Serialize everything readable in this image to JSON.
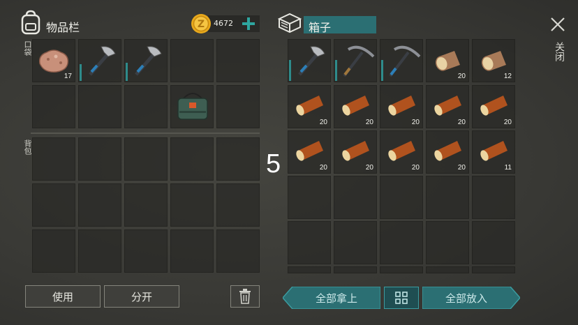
{
  "inventory": {
    "title": "物品栏",
    "coins": "4672",
    "pocket_label": "口袋",
    "backpack_label": "背包",
    "pocket_slots": [
      {
        "item": "stone",
        "count": "17"
      },
      {
        "item": "hatchet",
        "count": ""
      },
      {
        "item": "hatchet",
        "count": ""
      },
      {
        "item": "",
        "count": ""
      },
      {
        "item": "",
        "count": ""
      },
      {
        "item": "",
        "count": ""
      },
      {
        "item": "",
        "count": ""
      },
      {
        "item": "",
        "count": ""
      },
      {
        "item": "bag",
        "count": ""
      },
      {
        "item": "",
        "count": ""
      }
    ],
    "use_button": "使用",
    "split_button": "分开"
  },
  "box": {
    "title": "箱子",
    "close_label": "关闭",
    "slots": [
      {
        "item": "hatchet",
        "count": ""
      },
      {
        "item": "pickaxe",
        "count": ""
      },
      {
        "item": "pickaxe",
        "count": ""
      },
      {
        "item": "log",
        "count": "20"
      },
      {
        "item": "log",
        "count": "12"
      },
      {
        "item": "wood",
        "count": "20"
      },
      {
        "item": "wood",
        "count": "20"
      },
      {
        "item": "wood",
        "count": "20"
      },
      {
        "item": "wood",
        "count": "20"
      },
      {
        "item": "wood",
        "count": "20"
      },
      {
        "item": "wood",
        "count": "20"
      },
      {
        "item": "wood",
        "count": "20"
      },
      {
        "item": "wood",
        "count": "20"
      },
      {
        "item": "wood",
        "count": "20"
      },
      {
        "item": "wood",
        "count": "11"
      }
    ],
    "take_all_button": "全部拿上",
    "put_all_button": "全部放入"
  },
  "overlay_number": "5",
  "colors": {
    "teal": "#2b6f73",
    "coin": "#e8a91c"
  }
}
